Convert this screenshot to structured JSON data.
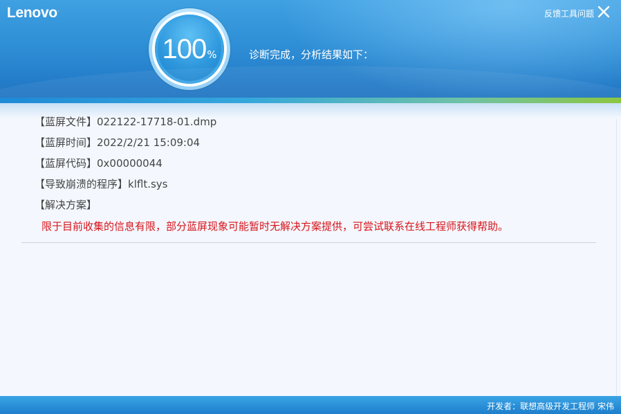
{
  "header": {
    "logo": "Lenovo",
    "logo_mark": ".",
    "feedback_label": "反馈工具问题",
    "progress_value": "100",
    "progress_unit": "%",
    "status_text": "诊断完成，分析结果如下："
  },
  "results": {
    "rows": [
      {
        "label": "【蓝屏文件】",
        "value": "022122-17718-01.dmp"
      },
      {
        "label": "【蓝屏时间】",
        "value": "2022/2/21 15:09:04"
      },
      {
        "label": "【蓝屏代码】",
        "value": "0x00000044"
      },
      {
        "label": "【导致崩溃的程序】",
        "value": "klflt.sys"
      },
      {
        "label": "【解决方案】",
        "value": ""
      }
    ],
    "solution_text": "限于目前收集的信息有限，部分蓝屏现象可能暂时无解决方案提供，可尝试联系在线工程师获得帮助。"
  },
  "footer": {
    "developer_text": "开发者：联想高级开发工程师 宋伟"
  },
  "colors": {
    "header_blue": "#2f8fd6",
    "solution_red": "#d8141b",
    "accent_green": "#8cc63f"
  }
}
